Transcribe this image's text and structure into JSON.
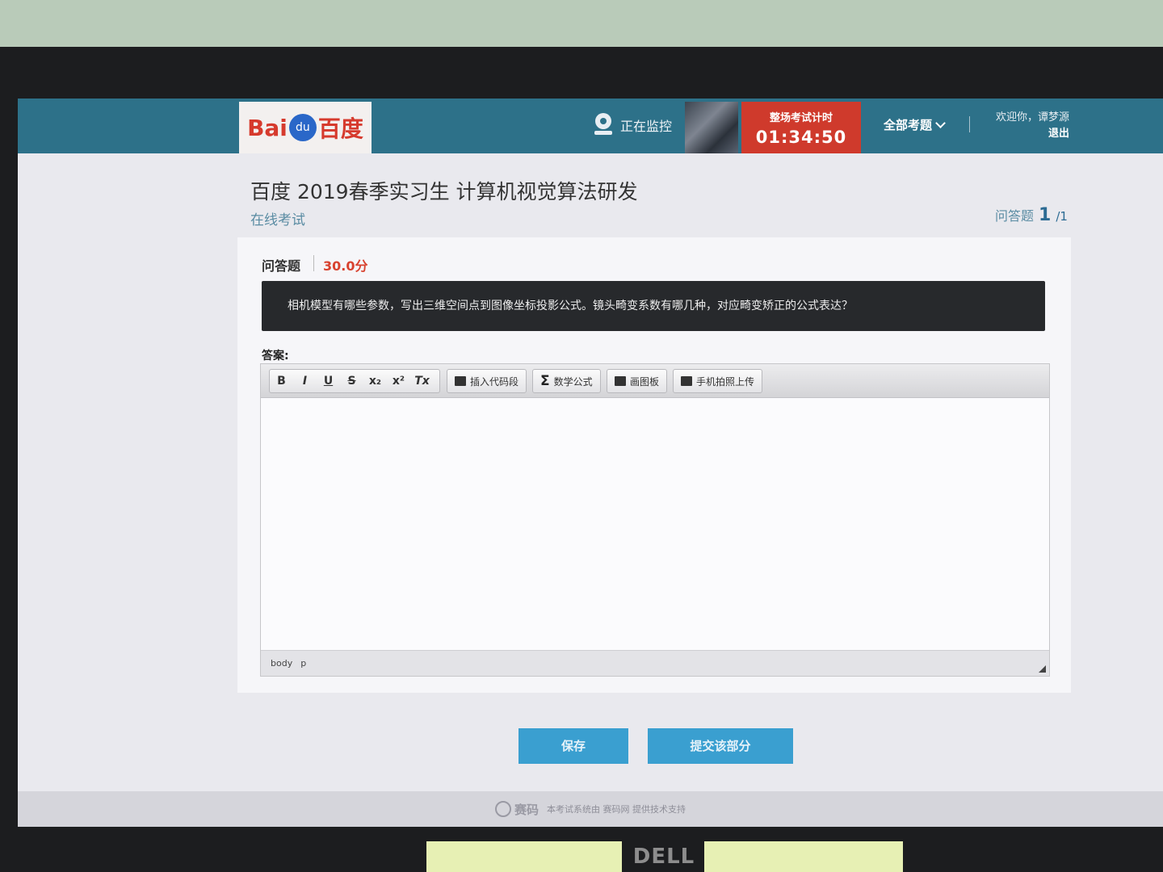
{
  "header": {
    "logo_left": "Bai",
    "logo_paw": "du",
    "logo_right": "百度",
    "monitor_status": "正在监控",
    "timer_label": "整场考试计时",
    "timer_value": "01:34:50",
    "all_questions": "全部考题",
    "welcome": "欢迎你，谭梦源",
    "logout": "退出"
  },
  "exam": {
    "title": "百度 2019春季实习生 计算机视觉算法研发",
    "subtitle": "在线考试",
    "counter_label": "问答题",
    "counter_current": "1",
    "counter_total": "/1"
  },
  "question": {
    "type": "问答题",
    "score": "30.0分",
    "text": "相机模型有哪些参数，写出三维空间点到图像坐标投影公式。镜头畸变系数有哪几种，对应畸变矫正的公式表达？"
  },
  "editor": {
    "answer_label": "答案:",
    "format_buttons": [
      "B",
      "I",
      "U",
      "S",
      "x₂",
      "x²",
      "Tx"
    ],
    "insert_code": "插入代码段",
    "math_formula": "数学公式",
    "drawing_board": "画图板",
    "phone_upload": "手机拍照上传",
    "status_path": [
      "body",
      "p"
    ]
  },
  "actions": {
    "save": "保存",
    "submit": "提交该部分"
  },
  "footer": {
    "brand": "赛码",
    "text": "本考试系统由 赛码网 提供技术支持"
  }
}
